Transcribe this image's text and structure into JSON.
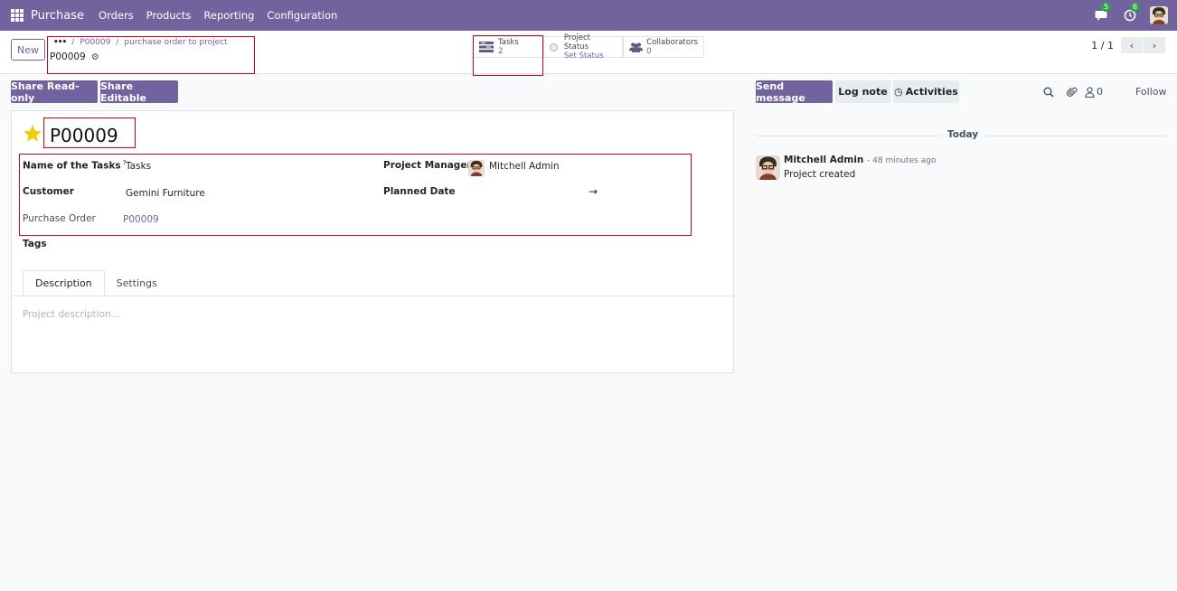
{
  "navbar": {
    "app_name": "Purchase",
    "menu": [
      "Orders",
      "Products",
      "Reporting",
      "Configuration"
    ],
    "messages_count": "5",
    "activities_count": "6"
  },
  "control": {
    "new_label": "New",
    "breadcrumb": [
      "P00009",
      "purchase order to project"
    ],
    "record_name": "P00009",
    "pager": "1 / 1"
  },
  "smart_buttons": {
    "tasks": {
      "label": "Tasks",
      "value": "2"
    },
    "status": {
      "label": "Project Status",
      "value": "Set Status"
    },
    "collaborators": {
      "label": "Collaborators",
      "value": "0"
    }
  },
  "actions": {
    "share_readonly": "Share Read-only",
    "share_editable": "Share Editable"
  },
  "form": {
    "title": "P00009",
    "fields": {
      "tasks_label": "Name of the Tasks",
      "tasks_help": "?",
      "tasks_value": "Tasks",
      "customer_label": "Customer",
      "customer_value": "Gemini Furniture",
      "po_label": "Purchase Order",
      "po_value": "P00009",
      "pm_label": "Project Manager",
      "pm_value": "Mitchell Admin",
      "planned_label": "Planned Date",
      "planned_arrow": "→",
      "tags_label": "Tags"
    },
    "tabs": [
      "Description",
      "Settings"
    ],
    "description_placeholder": "Project description..."
  },
  "chatter": {
    "send_message": "Send message",
    "log_note": "Log note",
    "activities": "Activities",
    "followers_count": "0",
    "follow": "Follow",
    "date_separator": "Today",
    "message": {
      "author": "Mitchell Admin",
      "time": "- 48 minutes ago",
      "body": "Project created"
    }
  },
  "colors": {
    "brand": "#71639e",
    "highlight": "#d0021b",
    "star": "#f3cc00",
    "badge": "#28a745"
  }
}
